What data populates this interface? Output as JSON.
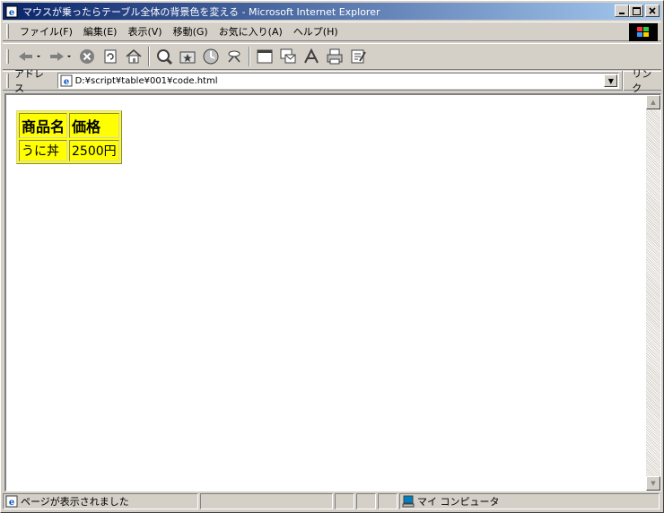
{
  "window": {
    "title": "マウスが乗ったらテーブル全体の背景色を変える - Microsoft Internet Explorer"
  },
  "menu": [
    "ファイル(F)",
    "編集(E)",
    "表示(V)",
    "移動(G)",
    "お気に入り(A)",
    "ヘルプ(H)"
  ],
  "address": {
    "label": "アドレス",
    "url": "D:¥script¥table¥001¥code.html",
    "links_label": "リンク"
  },
  "page": {
    "table": {
      "bg_color": "#ffff00",
      "headers": [
        "商品名",
        "価格"
      ],
      "rows": [
        [
          "うに丼",
          "2500円"
        ]
      ]
    }
  },
  "status": {
    "message": "ページが表示されました",
    "zone": "マイ コンピュータ"
  }
}
